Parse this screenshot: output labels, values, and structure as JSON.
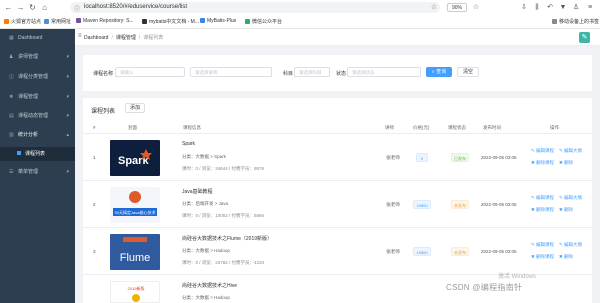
{
  "browser": {
    "url": "localhost:8520/#/eduservice/course/list",
    "zoom": "90%",
    "bookmarks": [
      {
        "label": "火狐官方站点",
        "color": "#ff7a00"
      },
      {
        "label": "常用网址",
        "color": "#4a90d9"
      },
      {
        "label": "Maven Repository: S...",
        "color": "#7a4ea3"
      },
      {
        "label": "mybatis中文文档 - M...",
        "color": "#333333"
      },
      {
        "label": "MyBatis-Plus",
        "color": "#3b82f6"
      },
      {
        "label": "微信公众平台",
        "color": "#2aae67"
      },
      {
        "label": "移动设备上的书签",
        "color": "#888888"
      }
    ]
  },
  "sidebar": {
    "items": [
      {
        "label": "Dashboard",
        "icon": "dashboard-icon"
      },
      {
        "label": "讲师管理",
        "icon": "teacher-icon"
      },
      {
        "label": "课程分类管理",
        "icon": "category-icon"
      },
      {
        "label": "课程管理",
        "icon": "course-icon"
      },
      {
        "label": "课程动态管理",
        "icon": "news-icon"
      },
      {
        "label": "统计分析",
        "icon": "stats-icon"
      },
      {
        "label": "课程列表",
        "icon": "list-icon"
      },
      {
        "label": "菜单管理",
        "icon": "menu-icon"
      }
    ]
  },
  "header": {
    "breadcrumb": [
      "Dashboard",
      "课程管理",
      "课程列表"
    ]
  },
  "filter": {
    "course_name_label": "课程名称",
    "course_name_placeholder": "请输入",
    "teacher_placeholder": "请选择讲师",
    "subject_label": "科目",
    "subject_placeholder": "请选择科目",
    "status_label": "状态",
    "status_placeholder": "请选择状态",
    "search_label": "查询",
    "reset_label": "清空"
  },
  "list": {
    "title": "课程列表",
    "add_label": "添加",
    "headers": [
      "#",
      "封面",
      "课程信息",
      "讲师",
      "价格(元)",
      "课程状态",
      "发布时间",
      "操作"
    ],
    "rows": [
      {
        "index": "1",
        "cover_text": "Spark",
        "name": "Spark",
        "meta": "分类：大数据 > Spark",
        "stat": "课时：0 / 浏览：24644 / 付费学员：9576",
        "teacher": "张老师",
        "price": "0",
        "status": "已发布",
        "time": "2022-09-05 03:05",
        "ops": [
          "编辑课程",
          "编辑大纲",
          "删除课程",
          "删除"
        ]
      },
      {
        "index": "2",
        "cover_text": "30天搞定Java核心技术",
        "name": "Java基础教程",
        "meta": "分类：后端开发 > Java",
        "stat": "课时：0 / 浏览：10052 / 付费学员：5866",
        "teacher": "张老师",
        "price": "19800",
        "status": "未发布",
        "time": "2022-09-05 03:05",
        "ops": [
          "编辑课程",
          "编辑大纲",
          "删除课程",
          "删除"
        ]
      },
      {
        "index": "3",
        "cover_text": "Flume",
        "name": "尚硅谷大数据技术之Flume（2019新版）",
        "meta": "分类：大数据 > Hadoop",
        "stat": "课时：0 / 浏览：23782 / 付费学员：4234",
        "teacher": "张老师",
        "price": "19800",
        "status": "未发布",
        "time": "2022-09-05 03:05",
        "ops": [
          "编辑课程",
          "编辑大纲",
          "删除课程",
          "删除"
        ]
      },
      {
        "index": "4",
        "cover_text": "2019新版",
        "name": "尚硅谷大数据技术之Hive",
        "meta": "分类：大数据 > Hadoop",
        "stat": "",
        "teacher": "",
        "price": "",
        "status": "",
        "time": "",
        "ops": []
      }
    ]
  },
  "watermark": {
    "windows": "激活 Windows",
    "csdn": "CSDN @编程指南针"
  }
}
